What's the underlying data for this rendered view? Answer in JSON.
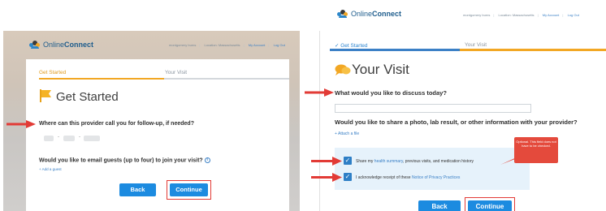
{
  "left": {
    "logo": {
      "brand_light": "Online",
      "brand_bold": "Connect"
    },
    "toplinks": {
      "user": "montgomery burns",
      "location": "Location: Massachusetts",
      "account": "My Account",
      "logout": "Log Out"
    },
    "steps": {
      "step1": "Get Started",
      "step2": "Your Visit"
    },
    "title": "Get Started",
    "question_phone": "Where can this provider call you for follow-up, if needed?",
    "question_guests": "Would you like to email guests (up to four) to join your visit?",
    "info_glyph": "i",
    "add_guest": "+ Add a guest",
    "back_label": "Back",
    "continue_label": "Continue"
  },
  "right": {
    "logo": {
      "brand_light": "Online",
      "brand_bold": "Connect"
    },
    "toplinks": {
      "user": "montgomery burns",
      "location": "Location: Massachusetts",
      "account": "My Account",
      "logout": "Log Out"
    },
    "steps": {
      "step1": "✓ Get Started",
      "step2": "Your Visit"
    },
    "title": "Your Visit",
    "question_discuss": "What would you like to discuss today?",
    "question_share": "Would you like to share a photo, lab result, or other information with your provider?",
    "attach": "+ Attach a file",
    "consent1_pre": "Share my ",
    "consent1_link": "health summary",
    "consent1_post": ", previous visits, and medication history",
    "consent2_pre": "I acknowledge receipt of these ",
    "consent2_link": "Notice of Privacy Practices",
    "check_glyph": "✓",
    "tooltip": "Optional. This field does not have to be checked.",
    "back_label": "Back",
    "continue_label": "Continue"
  },
  "colors": {
    "accent_blue": "#1c8be0",
    "accent_orange": "#f2a724",
    "annotation_red": "#e23b36"
  },
  "icons": [
    "people-logo-icon",
    "flag-icon",
    "chat-bubbles-icon",
    "info-icon",
    "check-icon",
    "red-arrow-icon"
  ]
}
